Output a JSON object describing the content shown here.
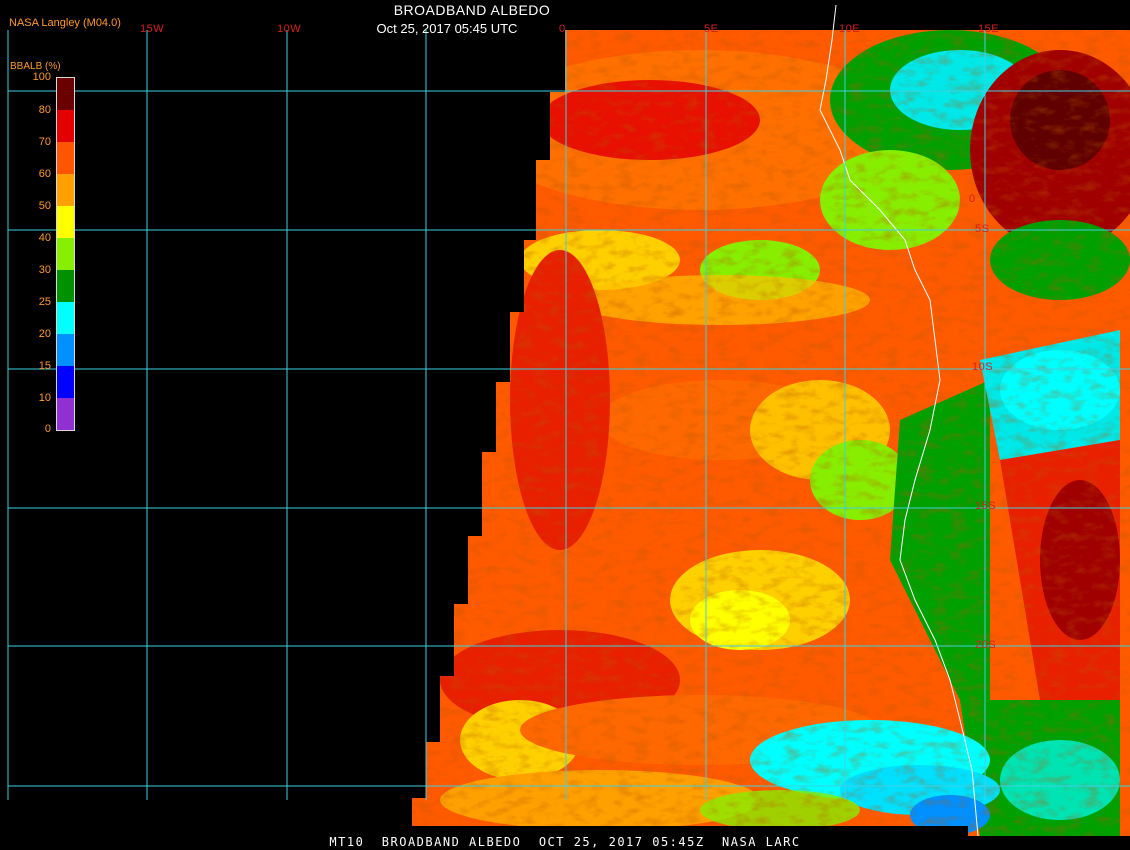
{
  "header": {
    "credit": "NASA Langley (M04.0)",
    "title": "BROADBAND ALBEDO",
    "subtitle": "Oct 25, 2017 05:45 UTC"
  },
  "colorbar": {
    "title": "BBALB (%)",
    "ticks": [
      "100",
      "80",
      "70",
      "60",
      "50",
      "40",
      "30",
      "25",
      "20",
      "15",
      "10",
      "0"
    ],
    "colors": [
      "#6a0000",
      "#e40000",
      "#ff5500",
      "#ffa000",
      "#ffff00",
      "#88ee00",
      "#009000",
      "#00ffff",
      "#0090ff",
      "#0000ff",
      "#9030d0"
    ]
  },
  "map": {
    "longitude_labels": [
      "15W",
      "10W",
      "0",
      "5E",
      "10E",
      "15E"
    ],
    "latitude_labels": [
      "0",
      "5S",
      "10S",
      "15S",
      "20S"
    ],
    "grid_color": "#40d0e0"
  },
  "footer": {
    "text": "MT10  BROADBAND ALBEDO  OCT 25, 2017 05:45Z  NASA LARC"
  }
}
